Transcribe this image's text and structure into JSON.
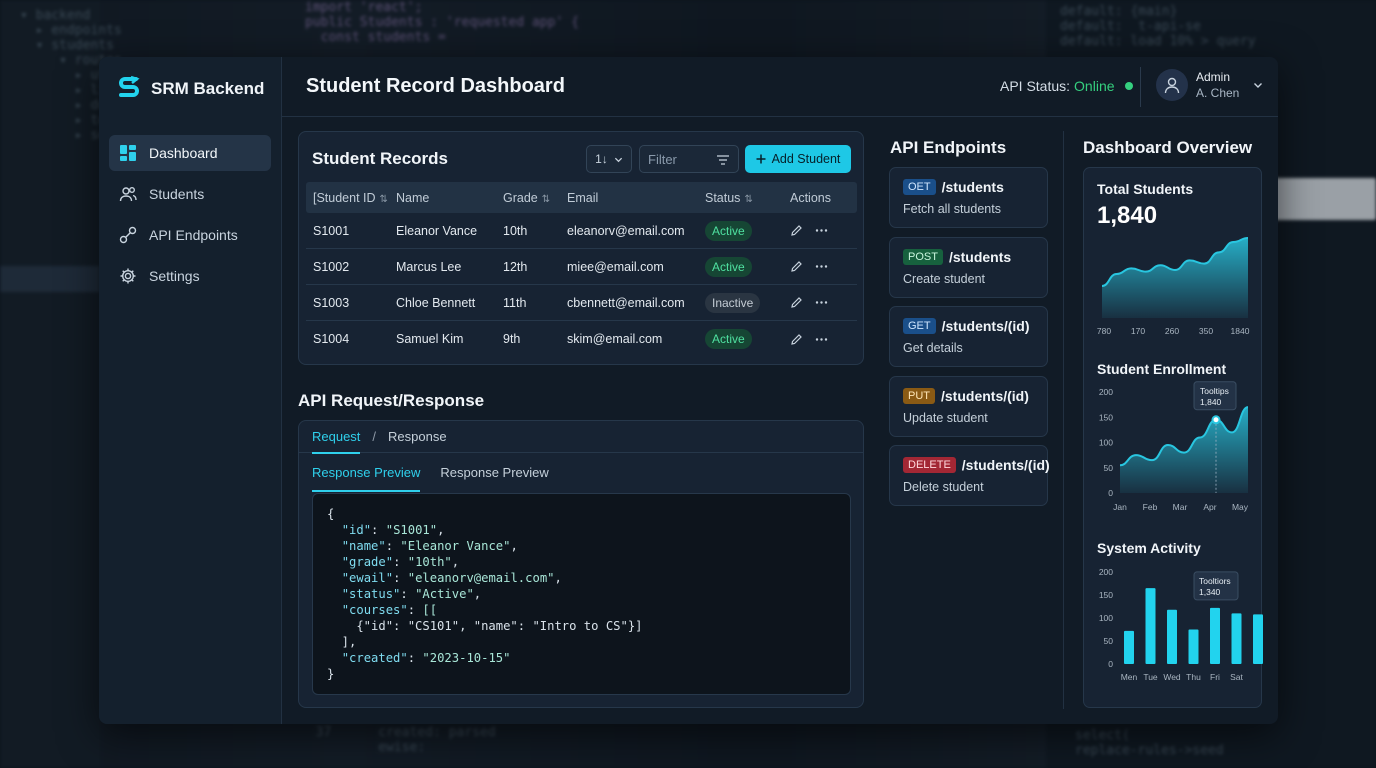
{
  "app": {
    "brand": "SRM Backend",
    "page_title": "Student Record Dashboard",
    "accent": "#1ec8e6"
  },
  "sidebar": {
    "items": [
      {
        "label": "Dashboard",
        "icon": "dashboard-icon",
        "active": true
      },
      {
        "label": "Students",
        "icon": "users-icon",
        "active": false
      },
      {
        "label": "API Endpoints",
        "icon": "link-icon",
        "active": false
      },
      {
        "label": "Settings",
        "icon": "gear-icon",
        "active": false
      }
    ]
  },
  "header": {
    "api_status_label": "API Status:",
    "api_status_value": "Online",
    "user_role": "Admin",
    "user_name": "A. Chen"
  },
  "records": {
    "title": "Student Records",
    "sort_label": "1↓",
    "filter_placeholder": "Filter",
    "add_label": "Add Student",
    "columns": [
      "[Student ID",
      "Name",
      "Grade",
      "Email",
      "Status",
      "Actions"
    ],
    "rows": [
      {
        "id": "S1001",
        "name": "Eleanor Vance",
        "grade": "10th",
        "email": "eleanorv@email.com",
        "status": "Active"
      },
      {
        "id": "S1002",
        "name": "Marcus Lee",
        "grade": "12th",
        "email": "miee@email.com",
        "status": "Active"
      },
      {
        "id": "S1003",
        "name": "Chloe Bennett",
        "grade": "11th",
        "email": "cbennett@email.com",
        "status": "Inactive"
      },
      {
        "id": "S1004",
        "name": "Samuel Kim",
        "grade": "9th",
        "email": "skim@email.com",
        "status": "Active"
      }
    ]
  },
  "api_panel": {
    "title": "API Request/Response",
    "tab_request": "Request",
    "tab_sep": "/",
    "tab_response": "Response",
    "subtab_1": "Response Preview",
    "subtab_2": "Response Preview",
    "json_lines": [
      {
        "text": "{"
      },
      {
        "indent": "  ",
        "key": "\"id\"",
        "val": "\"S1001\"",
        "tail": ","
      },
      {
        "indent": "  ",
        "key": "\"name\"",
        "val": "\"Eleanor Vance\"",
        "tail": ","
      },
      {
        "indent": "  ",
        "key": "\"grade\"",
        "val": "\"10th\"",
        "tail": ","
      },
      {
        "indent": "  ",
        "key": "\"ewail\"",
        "val": "\"eleanorv@email.com\"",
        "tail": ","
      },
      {
        "indent": "  ",
        "key": "\"status\"",
        "val": "\"Active\"",
        "tail": ","
      },
      {
        "indent": "  ",
        "key": "\"courses\"",
        "val": "[[",
        "tail": ""
      },
      {
        "text": "    {\"id\": \"CS101\", \"name\": \"Intro to CS\"}]"
      },
      {
        "text": "  ],"
      },
      {
        "indent": "  ",
        "key": "\"created\"",
        "val": "\"2023-10-15\"",
        "tail": ""
      },
      {
        "text": "}"
      }
    ]
  },
  "endpoints": {
    "title": "API Endpoints",
    "items": [
      {
        "method": "OET",
        "path": "/students",
        "desc": "Fetch all students",
        "kind": "get"
      },
      {
        "method": "POST",
        "path": "/students",
        "desc": "Create student",
        "kind": "post"
      },
      {
        "method": "GET",
        "path": "/students/(id)",
        "desc": "Get details",
        "kind": "get"
      },
      {
        "method": "PUT",
        "path": "/students/(id)",
        "desc": "Update student",
        "kind": "put"
      },
      {
        "method": "DELETE",
        "path": "/students/(id)",
        "desc": "Delete student",
        "kind": "del"
      }
    ]
  },
  "overview": {
    "title": "Dashboard Overview",
    "total_label": "Total Students",
    "total_value": "1,840",
    "enrollment_label": "Student Enrollment",
    "activity_label": "System Activity"
  },
  "chart_data": [
    {
      "type": "area",
      "title": "Total Students",
      "x_tick_labels": [
        "780",
        "170",
        "260",
        "350",
        "1840"
      ],
      "values": [
        40,
        55,
        62,
        58,
        66,
        60,
        72,
        68,
        82,
        95,
        100
      ],
      "color": "#29c6e0"
    },
    {
      "type": "area",
      "title": "Student Enrollment",
      "categories": [
        "Jan",
        "Feb",
        "Mar",
        "Apr",
        "May"
      ],
      "yticks": [
        0,
        50,
        100,
        150,
        200
      ],
      "ylim": [
        0,
        200
      ],
      "values": [
        55,
        75,
        65,
        95,
        80,
        110,
        145,
        120,
        170
      ],
      "tooltip": {
        "label": "Tooltips",
        "value": "1,840"
      },
      "color": "#29c6e0"
    },
    {
      "type": "bar",
      "title": "System Activity",
      "categories": [
        "Men",
        "Tue",
        "Wed",
        "Thu",
        "Fri",
        "Sat"
      ],
      "yticks": [
        0,
        50,
        100,
        150,
        200
      ],
      "ylim": [
        0,
        200
      ],
      "values": [
        72,
        165,
        118,
        75,
        122,
        110,
        108
      ],
      "tooltip": {
        "label": "Tooltiors",
        "value": "1,340"
      },
      "color": "#22d3ee"
    }
  ]
}
